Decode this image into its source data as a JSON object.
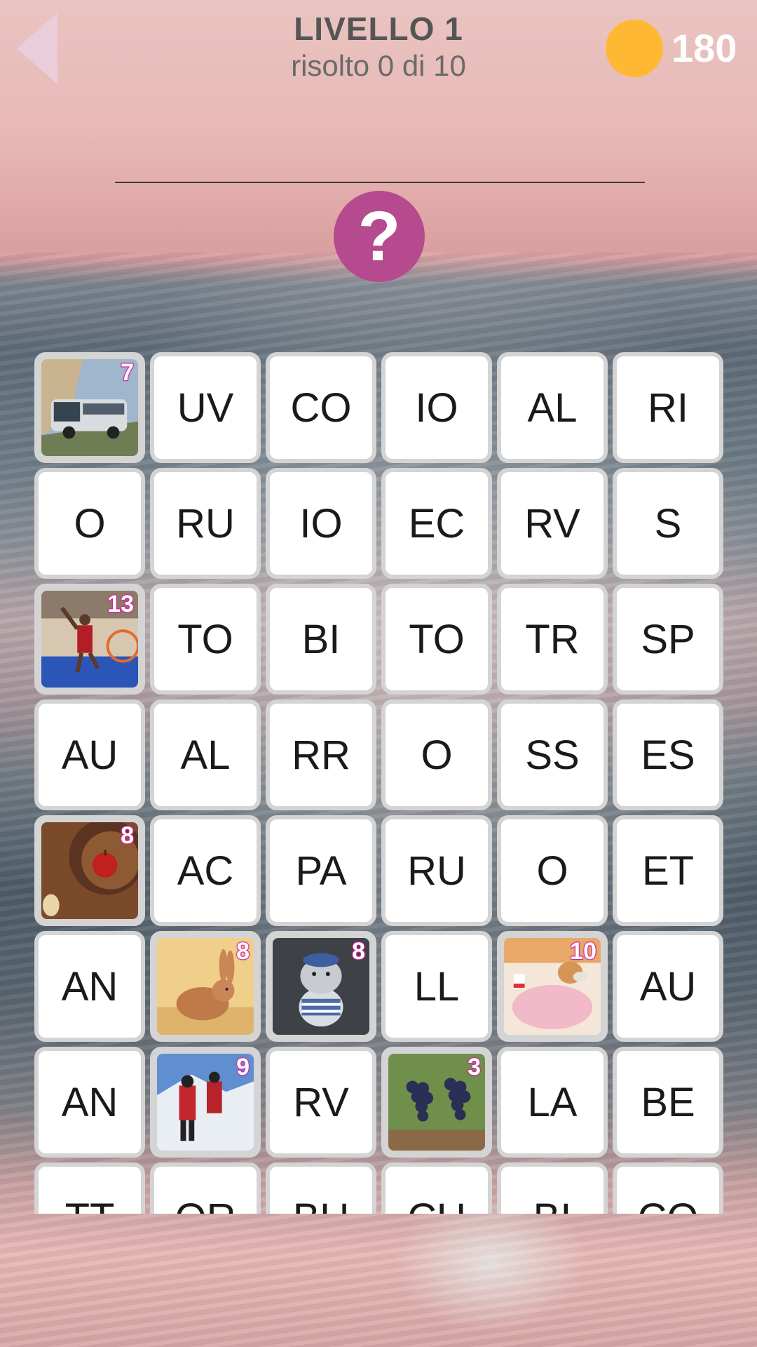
{
  "header": {
    "title": "LIVELLO 1",
    "subtitle": "risolto 0 di 10",
    "coins": "180"
  },
  "hint": {
    "label": "?"
  },
  "colors": {
    "hint_button": "#b54a8e",
    "coin": "#ffb833",
    "badge_outline": "#d0249a",
    "tile_border": "#d4d4d4"
  },
  "board": {
    "rows": [
      [
        {
          "type": "image",
          "image": "bus",
          "badge": "7"
        },
        {
          "text": "UV"
        },
        {
          "text": "CO"
        },
        {
          "text": "IO"
        },
        {
          "text": "AL"
        },
        {
          "text": "RI"
        }
      ],
      [
        {
          "text": "O"
        },
        {
          "text": "RU"
        },
        {
          "text": "IO"
        },
        {
          "text": "EC"
        },
        {
          "text": "RV"
        },
        {
          "text": "S"
        }
      ],
      [
        {
          "type": "image",
          "image": "basketball-player",
          "badge": "13"
        },
        {
          "text": "TO"
        },
        {
          "text": "BI"
        },
        {
          "text": "TO"
        },
        {
          "text": "TR"
        },
        {
          "text": "SP"
        }
      ],
      [
        {
          "text": "AU"
        },
        {
          "text": "AL"
        },
        {
          "text": "RR"
        },
        {
          "text": "O"
        },
        {
          "text": "SS"
        },
        {
          "text": "ES"
        }
      ],
      [
        {
          "type": "image",
          "image": "apple",
          "badge": "8"
        },
        {
          "text": "AC"
        },
        {
          "text": "PA"
        },
        {
          "text": "RU"
        },
        {
          "text": "O"
        },
        {
          "text": "ET"
        }
      ],
      [
        {
          "text": "AN"
        },
        {
          "type": "image",
          "image": "rabbit",
          "badge": "8"
        },
        {
          "type": "image",
          "image": "plush-hippo",
          "badge": "8"
        },
        {
          "text": "LL"
        },
        {
          "type": "image",
          "image": "dog-in-bathrobe",
          "badge": "10"
        },
        {
          "text": "AU"
        }
      ],
      [
        {
          "text": "AN"
        },
        {
          "type": "image",
          "image": "mountain-rescuers",
          "badge": "9"
        },
        {
          "text": "RV"
        },
        {
          "type": "image",
          "image": "grapes",
          "badge": "3"
        },
        {
          "text": "LA"
        },
        {
          "text": "BE"
        }
      ],
      [
        {
          "text": "TT"
        },
        {
          "text": "OR"
        },
        {
          "text": "BU"
        },
        {
          "text": "CU"
        },
        {
          "text": "BI"
        },
        {
          "text": "CO"
        }
      ]
    ]
  }
}
